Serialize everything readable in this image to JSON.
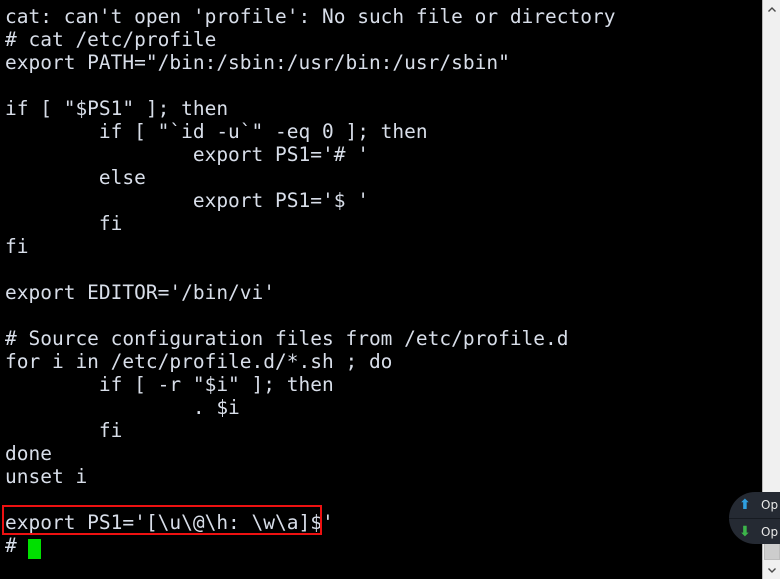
{
  "terminal": {
    "background_color": "#000000",
    "text_color": "#d8dee9",
    "cursor_color": "#00e000",
    "highlight_color": "#ee1111",
    "lines": [
      "cat: can't open 'profile': No such file or directory",
      "# cat /etc/profile",
      "export PATH=\"/bin:/sbin:/usr/bin:/usr/sbin\"",
      "",
      "if [ \"$PS1\" ]; then",
      "        if [ \"`id -u`\" -eq 0 ]; then",
      "                export PS1='# '",
      "        else",
      "                export PS1='$ '",
      "        fi",
      "fi",
      "",
      "export EDITOR='/bin/vi'",
      "",
      "# Source configuration files from /etc/profile.d",
      "for i in /etc/profile.d/*.sh ; do",
      "        if [ -r \"$i\" ]; then",
      "                . $i",
      "        fi",
      "done",
      "unset i",
      "",
      "export PS1='[\\u\\@\\h: \\w\\a]$'",
      "#"
    ]
  },
  "scrollbar": {
    "up_arrow": "▲",
    "down_arrow": "▼"
  },
  "overlay_widget": {
    "up_arrow": "⬆",
    "down_arrow": "⬇",
    "up_label": "Op",
    "down_label": "Op"
  }
}
